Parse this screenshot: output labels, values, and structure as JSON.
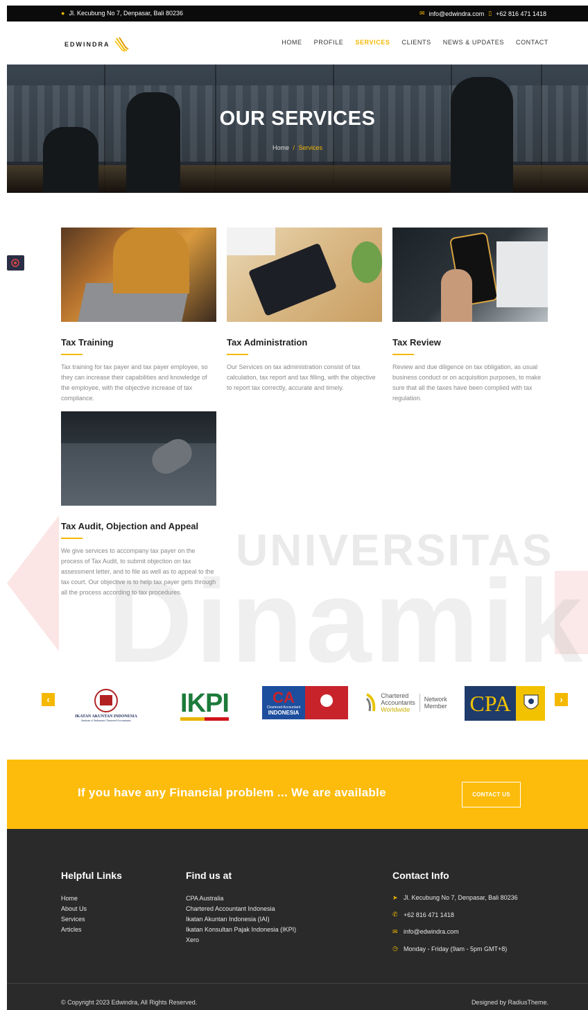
{
  "topbar": {
    "address": "Jl. Kecubung No 7, Denpasar, Bali 80236",
    "email": "info@edwindra.com",
    "phone": "+62 816 471 1418"
  },
  "brand": {
    "name": "EDWINDRA"
  },
  "nav": {
    "items": [
      "HOME",
      "PROFILE",
      "SERVICES",
      "CLIENTS",
      "NEWS & UPDATES",
      "CONTACT"
    ],
    "active": "SERVICES"
  },
  "hero": {
    "title": "OUR SERVICES",
    "breadcrumb_home": "Home",
    "breadcrumb_sep": "/",
    "breadcrumb_current": "Services"
  },
  "services": [
    {
      "title": "Tax Training",
      "text": "Tax training for tax payer and tax payer employee, so they can increase their capabilities and knowledge of the employee, with the objective increase of tax compliance."
    },
    {
      "title": "Tax Administration",
      "text": "Our Services on tax administration consist of tax calculation, tax report and tax filling, with the objective to report tax correctly, accurate and timely."
    },
    {
      "title": "Tax Review",
      "text": "Review and due diligence on tax obligation, as usual business conduct or on acquisition purposes, to make sure that all the taxes have been complied with tax regulation."
    },
    {
      "title": "Tax Audit, Objection and Appeal",
      "text": "We give services to accompany tax payer on the process of Tax Audit, to submit objection on tax assessment letter, and to file as well as to appeal to the tax court. Our objective is to help tax payer gets through all the process according to tax procedures."
    }
  ],
  "partners": {
    "iai_caption": "IKATAN AKUNTAN INDONESIA",
    "iai_sub": "Institute of Indonesia Chartered Accountants",
    "ikpi": "IKPI",
    "ca_big": "CA",
    "ca_sub1": "Chartered Accountant",
    "ca_sub2": "INDONESIA",
    "caw_line1": "Chartered",
    "caw_line2": "Accountants",
    "caw_line3": "Worldwide",
    "caw_member1": "Network",
    "caw_member2": "Member",
    "cpa": "CPA",
    "prev": "‹",
    "next": "›"
  },
  "cta": {
    "text": "If you have any Financial problem ... We are available",
    "button": "CONTACT US"
  },
  "footer": {
    "helpful_title": "Helpful Links",
    "helpful_links": [
      "Home",
      "About Us",
      "Services",
      "Articles"
    ],
    "find_title": "Find us at",
    "find_links": [
      "CPA Australia",
      "Chartered Accountant Indonesia",
      "Ikatan Akuntan Indonesia (IAI)",
      "Ikatan Konsultan Pajak Indonesia (IKPI)",
      "Xero"
    ],
    "contact_title": "Contact Info",
    "contact": {
      "address": "Jl. Kecubung No 7, Denpasar, Bali 80236",
      "phone": "+62 816 471 1418",
      "email": "info@edwindra.com",
      "hours": "Monday - Friday (9am - 5pm GMT+8)"
    },
    "copyright": "© Copyright 2023 Edwindra, All Rights Reserved.",
    "designed": "Designed by RadiusTheme."
  },
  "watermark": {
    "line1": "UNIVERSITAS",
    "line2": "Dinamika"
  },
  "colors": {
    "accent": "#f5b800",
    "cta_bg": "#fdbb0c",
    "footer_bg": "#2a2a2a",
    "topbar_bg": "#0b0b0b"
  }
}
